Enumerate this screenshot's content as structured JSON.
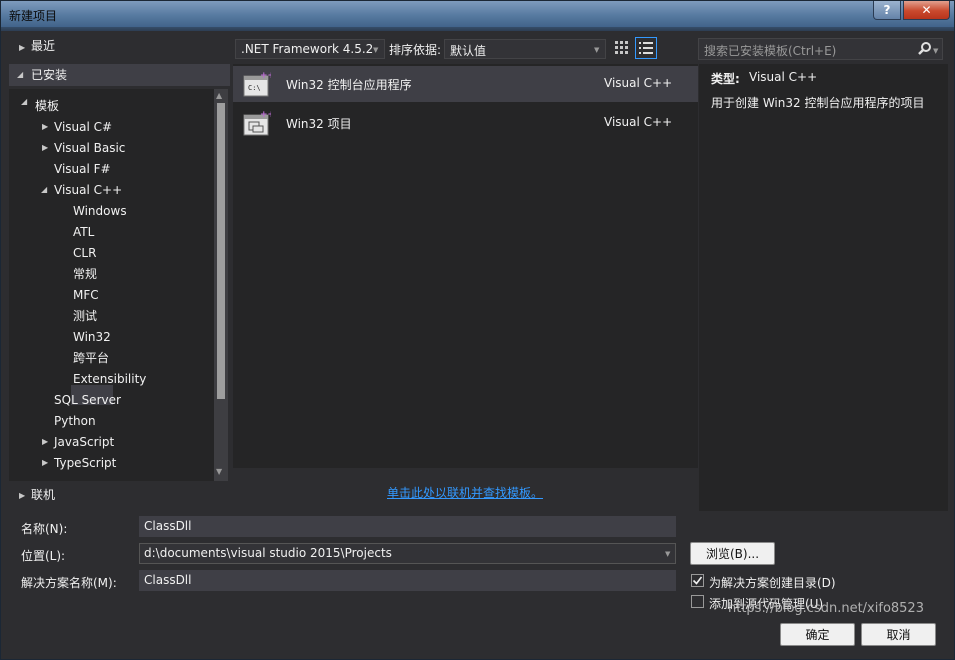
{
  "window": {
    "title": "新建项目",
    "help": "?",
    "close": "✕"
  },
  "tree": {
    "recent": "最近",
    "installed": "已安装",
    "templates": "模板",
    "items": [
      {
        "label": "Visual C#"
      },
      {
        "label": "Visual Basic"
      },
      {
        "label": "Visual F#"
      },
      {
        "label": "Visual C++"
      },
      {
        "label": "Windows"
      },
      {
        "label": "ATL"
      },
      {
        "label": "CLR"
      },
      {
        "label": "常规"
      },
      {
        "label": "MFC"
      },
      {
        "label": "测试"
      },
      {
        "label": "Win32"
      },
      {
        "label": "跨平台"
      },
      {
        "label": "Extensibility"
      },
      {
        "label": "SQL Server"
      },
      {
        "label": "Python"
      },
      {
        "label": "JavaScript"
      },
      {
        "label": "TypeScript"
      }
    ],
    "online": "联机"
  },
  "toolbar": {
    "framework": ".NET Framework 4.5.2",
    "sort_label": "排序依据:",
    "sort_value": "默认值",
    "search_placeholder": "搜索已安装模板(Ctrl+E)"
  },
  "templates": [
    {
      "name": "Win32 控制台应用程序",
      "lang": "Visual C++",
      "icon_text": "C:\\"
    },
    {
      "name": "Win32 项目",
      "lang": "Visual C++"
    }
  ],
  "online_link": "单击此处以联机并查找模板。",
  "description": {
    "type_label": "类型:",
    "type_value": "Visual C++",
    "text": "用于创建 Win32 控制台应用程序的项目"
  },
  "form": {
    "name_label": "名称(N):",
    "name_value": "ClassDll",
    "location_label": "位置(L):",
    "location_value": "d:\\documents\\visual studio 2015\\Projects",
    "solution_label": "解决方案名称(M):",
    "solution_value": "ClassDll",
    "browse": "浏览(B)...",
    "create_dir": "为解决方案创建目录(D)",
    "add_source_control": "添加到源代码管理(U)",
    "ok": "确定",
    "cancel": "取消"
  },
  "watermark": "https://blog.csdn.net/xifo8523"
}
